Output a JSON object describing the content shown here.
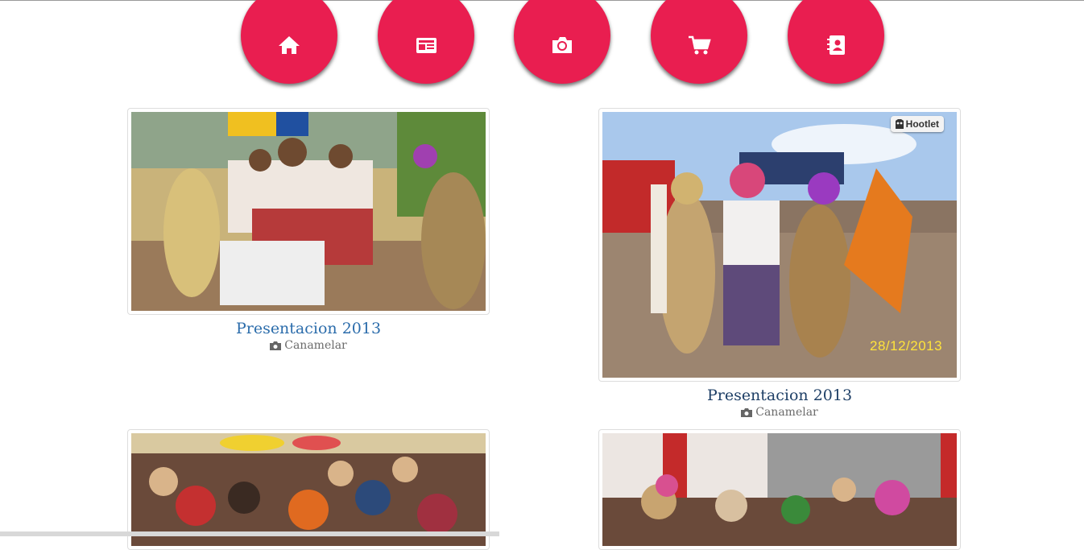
{
  "nav": {
    "items": [
      {
        "icon": "home-icon"
      },
      {
        "icon": "newspaper-icon"
      },
      {
        "icon": "camera-icon"
      },
      {
        "icon": "cart-icon"
      },
      {
        "icon": "contacts-icon"
      }
    ],
    "color": "#e91e50"
  },
  "gallery": [
    {
      "title": "Presentacion 2013",
      "album": "Canamelar"
    },
    {
      "title": "Presentacion 2013",
      "album": "Canamelar",
      "badge": "Hootlet",
      "date_stamp": "28/12/2013"
    },
    {
      "title": "",
      "album": ""
    },
    {
      "title": "",
      "album": ""
    }
  ]
}
